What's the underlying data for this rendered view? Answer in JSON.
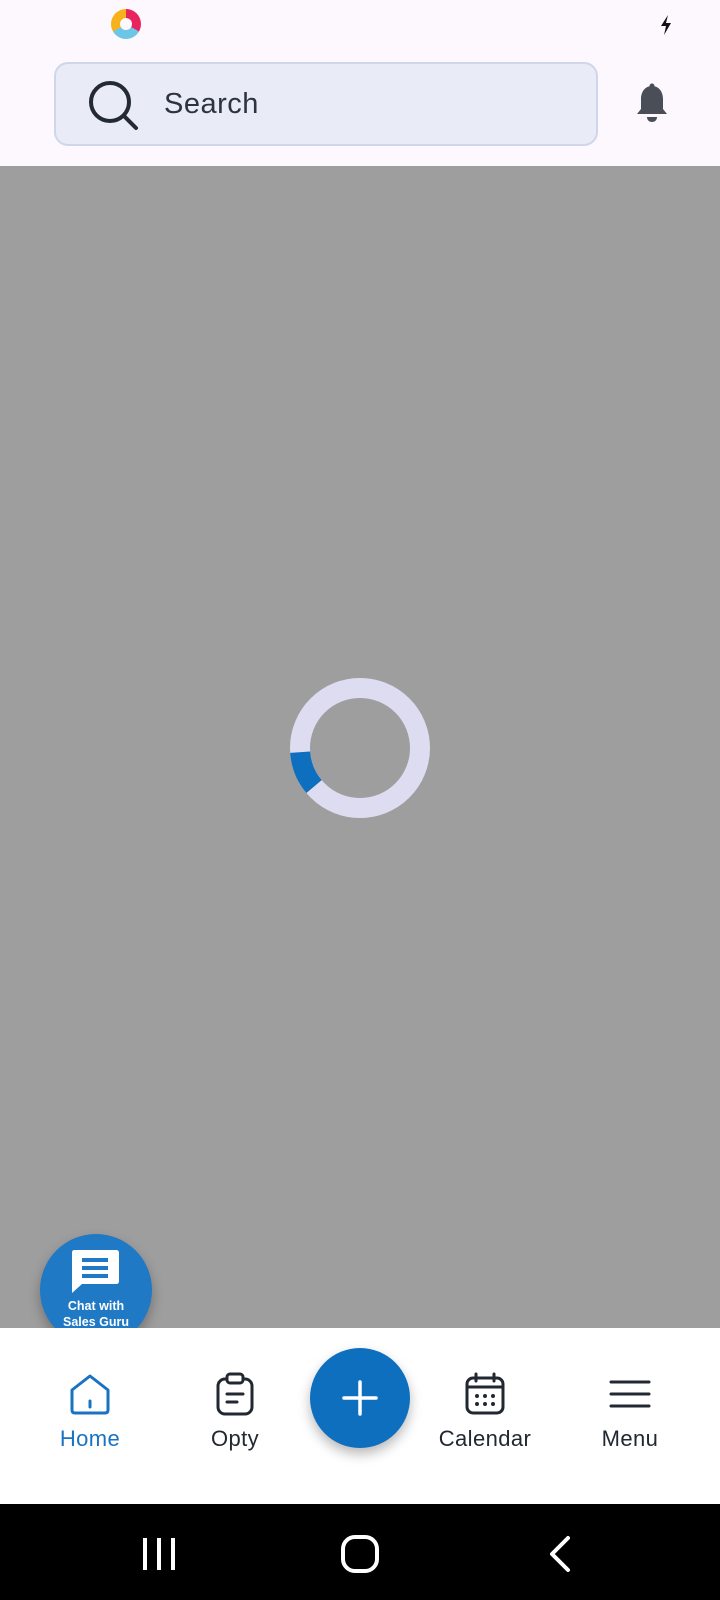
{
  "search": {
    "placeholder": "Search"
  },
  "chat_fab": {
    "line1": "Chat with",
    "line2": "Sales Guru"
  },
  "bottom_nav": {
    "items": [
      {
        "label": "Home",
        "icon": "home-icon",
        "active": true
      },
      {
        "label": "Opty",
        "icon": "clipboard-icon",
        "active": false
      },
      {
        "label": "Calendar",
        "icon": "calendar-icon",
        "active": false
      },
      {
        "label": "Menu",
        "icon": "hamburger-menu-icon",
        "active": false
      }
    ]
  },
  "loading": {
    "progress": 0.1
  },
  "colors": {
    "accent": "#0f6fbf",
    "active_nav": "#1a73c2",
    "overlay": "#9e9e9e",
    "search_background": "#e9ebf7",
    "spinner_track": "#dedcf0"
  }
}
